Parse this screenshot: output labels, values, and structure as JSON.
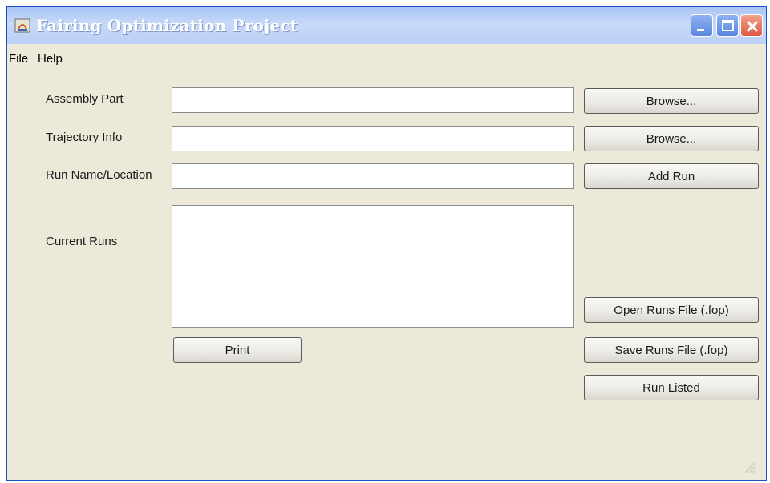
{
  "window": {
    "title": "Fairing Optimization Project",
    "controls": [
      "minimize-icon",
      "maximize-icon",
      "close-icon"
    ]
  },
  "menu": {
    "items": [
      "File",
      "Help"
    ]
  },
  "form": {
    "assembly_part": {
      "label": "Assembly Part",
      "value": "",
      "button": "Browse..."
    },
    "trajectory_info": {
      "label": "Trajectory Info",
      "value": "",
      "button": "Browse..."
    },
    "run_name": {
      "label": "Run Name/Location",
      "value": "",
      "button": "Add Run"
    },
    "current_runs": {
      "label": "Current Runs",
      "items": []
    }
  },
  "buttons": {
    "print": "Print",
    "open_runs": "Open Runs File (.fop)",
    "save_runs": "Save Runs File (.fop)",
    "run_listed": "Run Listed"
  },
  "colors": {
    "background": "#ece9d8",
    "titlebar": "#bcd0f6",
    "close": "#dd5b42"
  }
}
